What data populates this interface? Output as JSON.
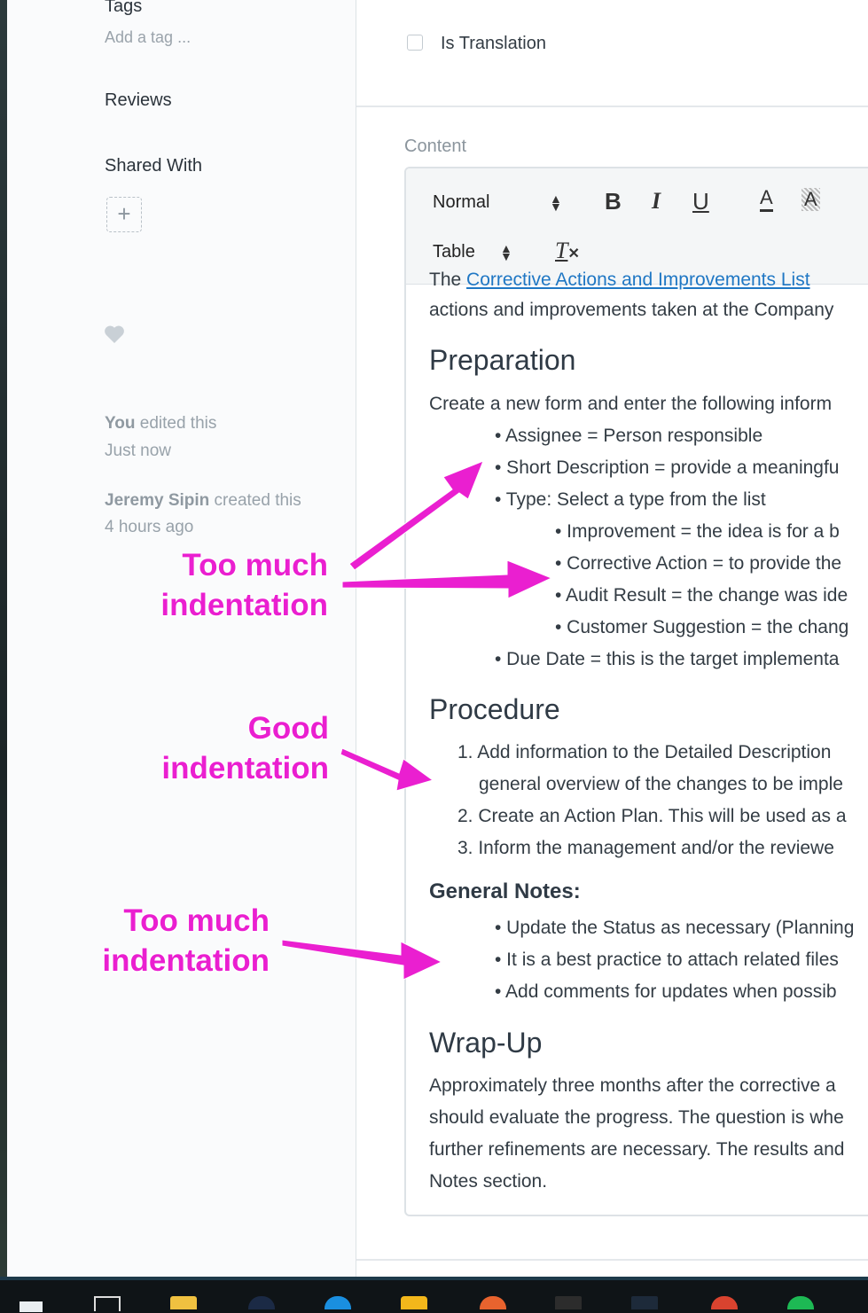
{
  "sidebar": {
    "tags_heading": "Tags",
    "tags_placeholder": "Add a tag ...",
    "reviews_heading": "Reviews",
    "shared_heading": "Shared With",
    "add_share_symbol": "+",
    "activity": [
      {
        "actor": "You",
        "action": " edited this",
        "time": "Just now"
      },
      {
        "actor": "Jeremy Sipin",
        "action": " created this",
        "time": "4 hours ago"
      }
    ]
  },
  "form": {
    "is_translation_label": "Is Translation",
    "content_label": "Content"
  },
  "toolbar": {
    "format_select": "Normal",
    "table_select": "Table",
    "bold": "B",
    "italic": "I",
    "underline": "U",
    "font_color": "A",
    "highlight": "A",
    "clear_format": "T"
  },
  "document": {
    "intro_link": "Corrective Actions and Improvements List",
    "intro_pre": "The ",
    "intro_line2": "actions and improvements taken at the Company",
    "preparation_heading": "Preparation",
    "preparation_intro": "Create a new form and enter the following inform",
    "prep_items": [
      "• Assignee = Person responsible",
      "• Short Description = provide a meaningfu",
      "• Type: Select a type from the list"
    ],
    "type_items": [
      "• Improvement = the idea is for a b",
      "• Corrective Action = to provide the",
      "• Audit Result = the change was ide",
      "• Customer Suggestion = the chang"
    ],
    "due_item": "• Due Date = this is the target implementa",
    "procedure_heading": "Procedure",
    "procedure_items": [
      "1. Add information to the Detailed Description",
      "general overview of the changes to be imple",
      "2. Create an Action Plan. This will be used as a",
      "3. Inform the management and/or the reviewe"
    ],
    "notes_heading": "General Notes:",
    "notes_items": [
      "• Update the Status as necessary (Planning",
      "• It is a best practice to attach related files",
      "• Add comments for updates when possib"
    ],
    "wrapup_heading": "Wrap-Up",
    "wrapup_lines": [
      "Approximately three months after the corrective a",
      "should evaluate the progress. The question is whe",
      "further refinements are necessary. The results and",
      "Notes section."
    ]
  },
  "annotations": {
    "too_much_1_line1": "Too much",
    "too_much_1_line2": "indentation",
    "good_line1": "Good",
    "good_line2": "indentation",
    "too_much_2_line1": "Too much",
    "too_much_2_line2": "indentation",
    "color": "#ea1fd0"
  },
  "taskbar": {
    "icons": [
      "start-icon",
      "task-view-icon",
      "file-explorer-icon",
      "steam-icon",
      "wifi-app-icon",
      "app-icon",
      "browser-icon",
      "epic-games-icon",
      "app-icon",
      "chrome-icon",
      "spotify-icon"
    ]
  }
}
